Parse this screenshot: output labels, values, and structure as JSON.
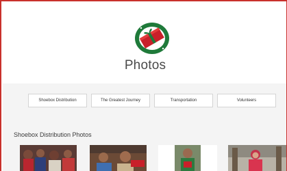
{
  "header": {
    "logo_alt": "Operation Christmas Child logo",
    "title": "Photos"
  },
  "tabs": [
    {
      "label": "Shoebox Distribution"
    },
    {
      "label": "The Greatest Journey"
    },
    {
      "label": "Transportation"
    },
    {
      "label": "Volunteers"
    }
  ],
  "section": {
    "title": "Shoebox Distribution Photos"
  },
  "colors": {
    "border_accent": "#c9302c",
    "logo_green": "#1f7a3a",
    "logo_red": "#c8202a",
    "content_bg": "#f4f4f4"
  }
}
